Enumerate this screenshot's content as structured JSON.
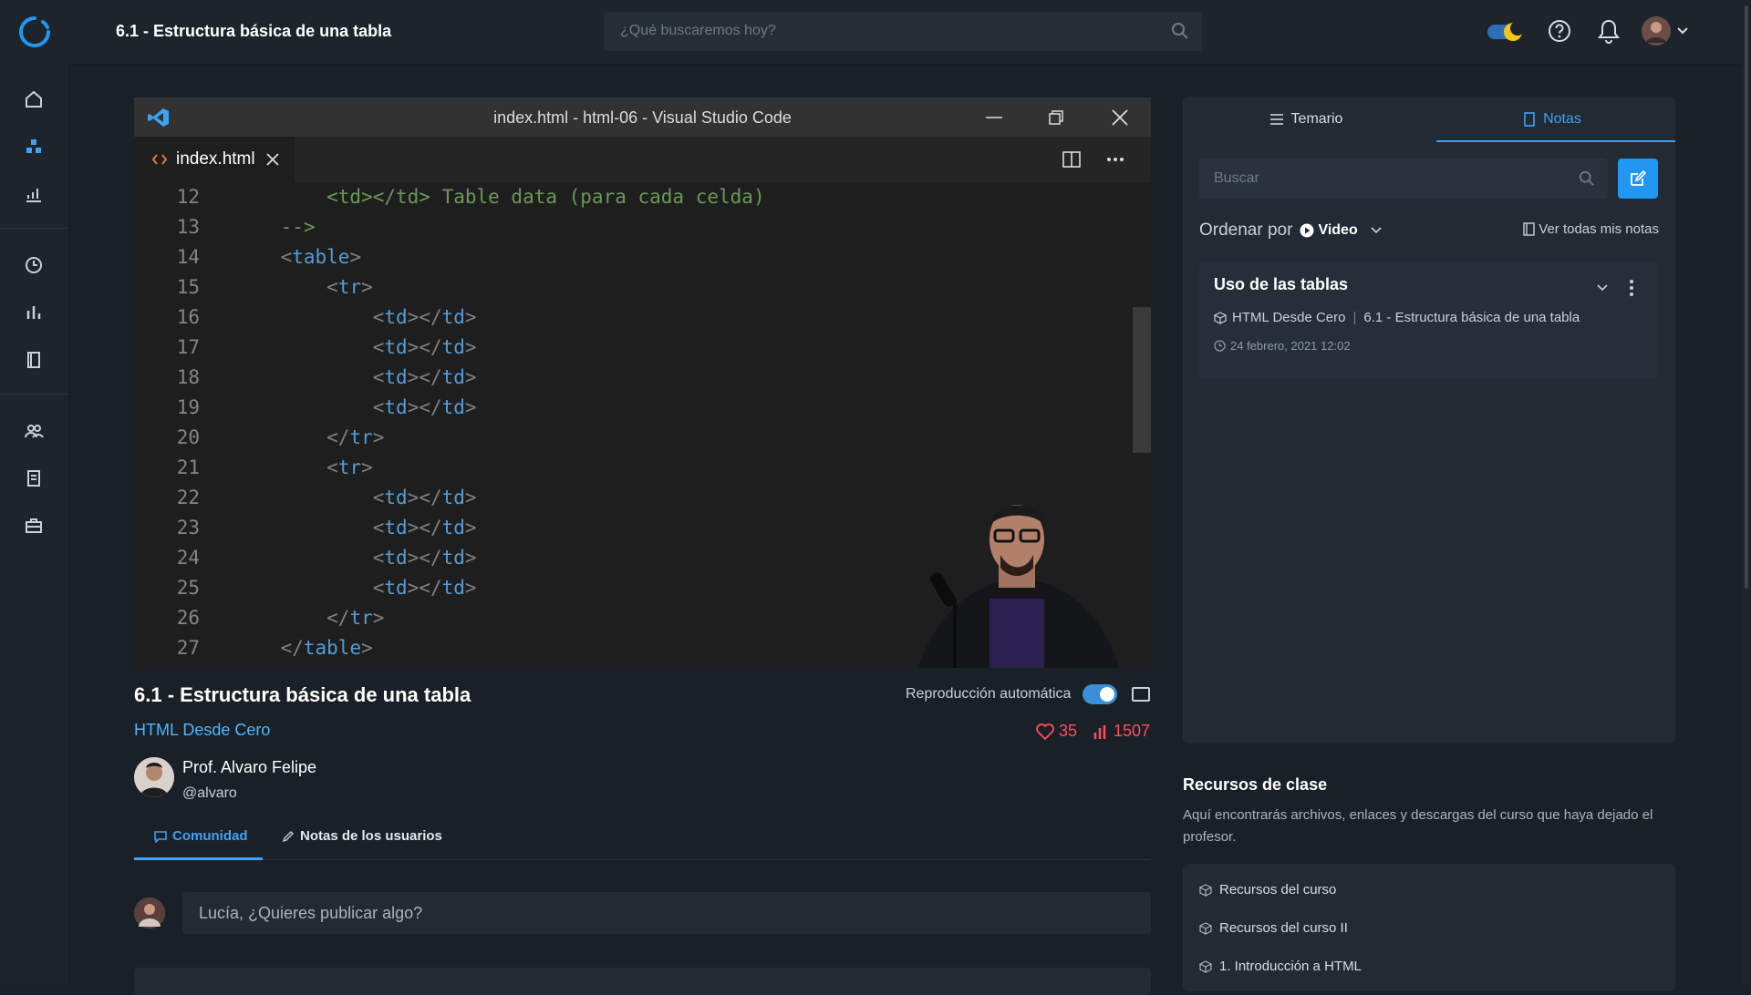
{
  "header": {
    "title": "6.1 - Estructura básica de una tabla",
    "search_placeholder": "¿Qué buscaremos hoy?"
  },
  "sidebar": {
    "items": [
      "home-icon",
      "courses-icon",
      "progress-icon",
      "history-icon",
      "stats-icon",
      "notebook-icon",
      "community-icon",
      "document-icon",
      "briefcase-icon"
    ]
  },
  "video": {
    "window_title": "index.html - html-06 - Visual Studio Code",
    "tab_label": "index.html",
    "code_lines": [
      {
        "n": "12",
        "code": "        <td></td> Table data (para cada celda)"
      },
      {
        "n": "13",
        "code": "    -->"
      },
      {
        "n": "14",
        "code": "    <table>"
      },
      {
        "n": "15",
        "code": "        <tr>"
      },
      {
        "n": "16",
        "code": "            <td></td>"
      },
      {
        "n": "17",
        "code": "            <td></td>"
      },
      {
        "n": "18",
        "code": "            <td></td>"
      },
      {
        "n": "19",
        "code": "            <td></td>"
      },
      {
        "n": "20",
        "code": "        </tr>"
      },
      {
        "n": "21",
        "code": "        <tr>"
      },
      {
        "n": "22",
        "code": "            <td></td>"
      },
      {
        "n": "23",
        "code": "            <td></td>"
      },
      {
        "n": "24",
        "code": "            <td></td>"
      },
      {
        "n": "25",
        "code": "            <td></td>"
      },
      {
        "n": "26",
        "code": "        </tr>"
      },
      {
        "n": "27",
        "code": "    </table>"
      }
    ]
  },
  "lesson": {
    "title": "6.1 - Estructura básica de una tabla",
    "course": "HTML Desde Cero",
    "autoplay_label": "Reproducción automática",
    "autoplay_on": true,
    "likes": "35",
    "views": "1507",
    "author_name": "Prof. Alvaro Felipe",
    "author_handle": "@alvaro"
  },
  "tabs": {
    "community": "Comunidad",
    "user_notes": "Notas de los usuarios"
  },
  "post": {
    "placeholder": "Lucía, ¿Quieres publicar algo?"
  },
  "notes_panel": {
    "tab_syllabus": "Temario",
    "tab_notes": "Notas",
    "search_placeholder": "Buscar",
    "order_label": "Ordenar por",
    "order_value": "Video",
    "view_all": "Ver todas mis notas",
    "note": {
      "title": "Uso de las tablas",
      "course": "HTML Desde Cero",
      "lesson": "6.1 - Estructura básica de una tabla",
      "date": "24 febrero, 2021 12:02"
    }
  },
  "resources": {
    "title": "Recursos de clase",
    "description": "Aquí encontrarás archivos, enlaces y descargas del curso que haya dejado el profesor.",
    "items": [
      "Recursos del curso",
      "Recursos del curso II",
      "1. Introducción a HTML"
    ]
  },
  "colors": {
    "accent": "#3fa2f7",
    "link": "#4fb6ff",
    "like": "#ff4d5e",
    "background": "#1a2027"
  }
}
